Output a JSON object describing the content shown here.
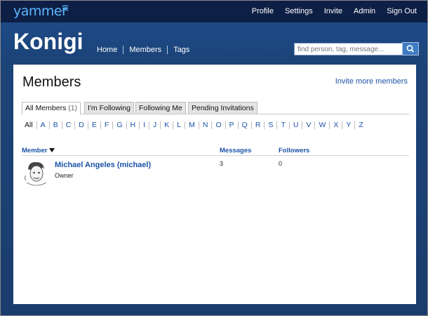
{
  "app": {
    "logo": "yammer"
  },
  "topnav": [
    "Profile",
    "Settings",
    "Invite",
    "Admin",
    "Sign Out"
  ],
  "network": {
    "name": "Konigi",
    "nav": [
      "Home",
      "Members",
      "Tags"
    ]
  },
  "search": {
    "placeholder": "find person, tag, message..."
  },
  "page": {
    "title": "Members",
    "invite_link": "Invite more members"
  },
  "tabs": [
    {
      "label": "All Members",
      "count": "(1)",
      "active": true
    },
    {
      "label": "I'm Following",
      "count": "",
      "active": false
    },
    {
      "label": "Following Me",
      "count": "",
      "active": false
    },
    {
      "label": "Pending Invitations",
      "count": "",
      "active": false
    }
  ],
  "letters": [
    "All",
    "A",
    "B",
    "C",
    "D",
    "E",
    "F",
    "G",
    "H",
    "I",
    "J",
    "K",
    "L",
    "M",
    "N",
    "O",
    "P",
    "Q",
    "R",
    "S",
    "T",
    "U",
    "V",
    "W",
    "X",
    "Y",
    "Z"
  ],
  "table": {
    "headers": {
      "member": "Member",
      "messages": "Messages",
      "followers": "Followers"
    },
    "rows": [
      {
        "name": "Michael Angeles (michael)",
        "role": "Owner",
        "messages": "3",
        "followers": "0"
      }
    ]
  },
  "colors": {
    "accent": "#1b53a7",
    "header_dark": "#0d1f45",
    "page_blue": "#1d4a86"
  }
}
